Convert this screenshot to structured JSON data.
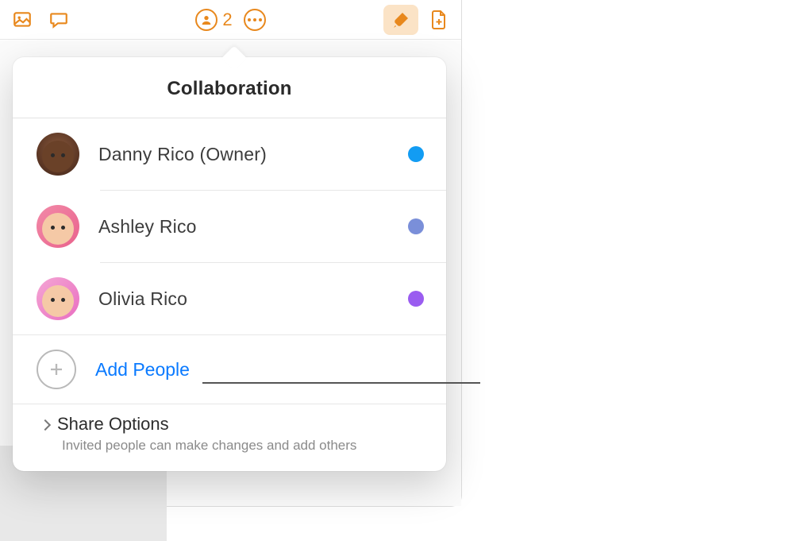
{
  "toolbar": {
    "collaborator_count": "2",
    "accent_color": "#e8881d"
  },
  "popover": {
    "title": "Collaboration",
    "people": [
      {
        "name": "Danny Rico (Owner)",
        "dot_color": "#129cf3"
      },
      {
        "name": "Ashley Rico",
        "dot_color": "#7a8fd9"
      },
      {
        "name": "Olivia Rico",
        "dot_color": "#9a5cf0"
      }
    ],
    "add_label": "Add People",
    "share": {
      "title": "Share Options",
      "subtitle": "Invited people can make changes and add others"
    }
  }
}
